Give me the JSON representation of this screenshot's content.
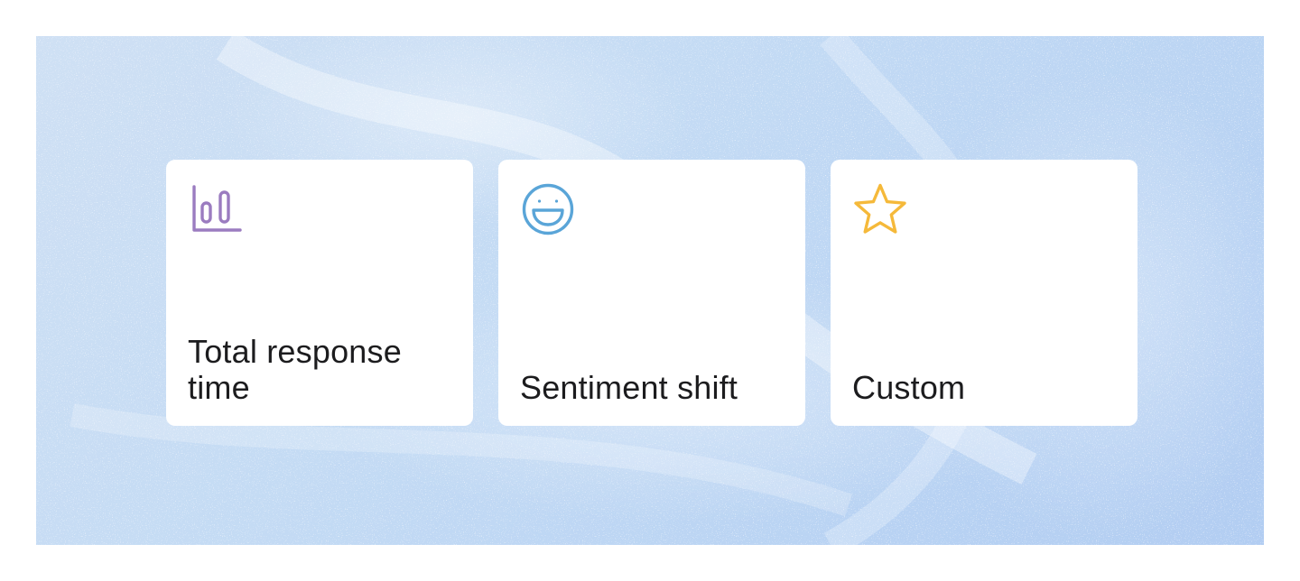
{
  "cards": [
    {
      "label": "Total response time",
      "icon": "bar-chart-icon",
      "icon_color": "#9b7cc0"
    },
    {
      "label": "Sentiment shift",
      "icon": "smiley-face-icon",
      "icon_color": "#5aa5d8"
    },
    {
      "label": "Custom",
      "icon": "star-icon",
      "icon_color": "#f5b93a"
    }
  ],
  "colors": {
    "banner_background": "#c4dbf4",
    "card_background": "#ffffff",
    "text": "#1c1c1e"
  }
}
